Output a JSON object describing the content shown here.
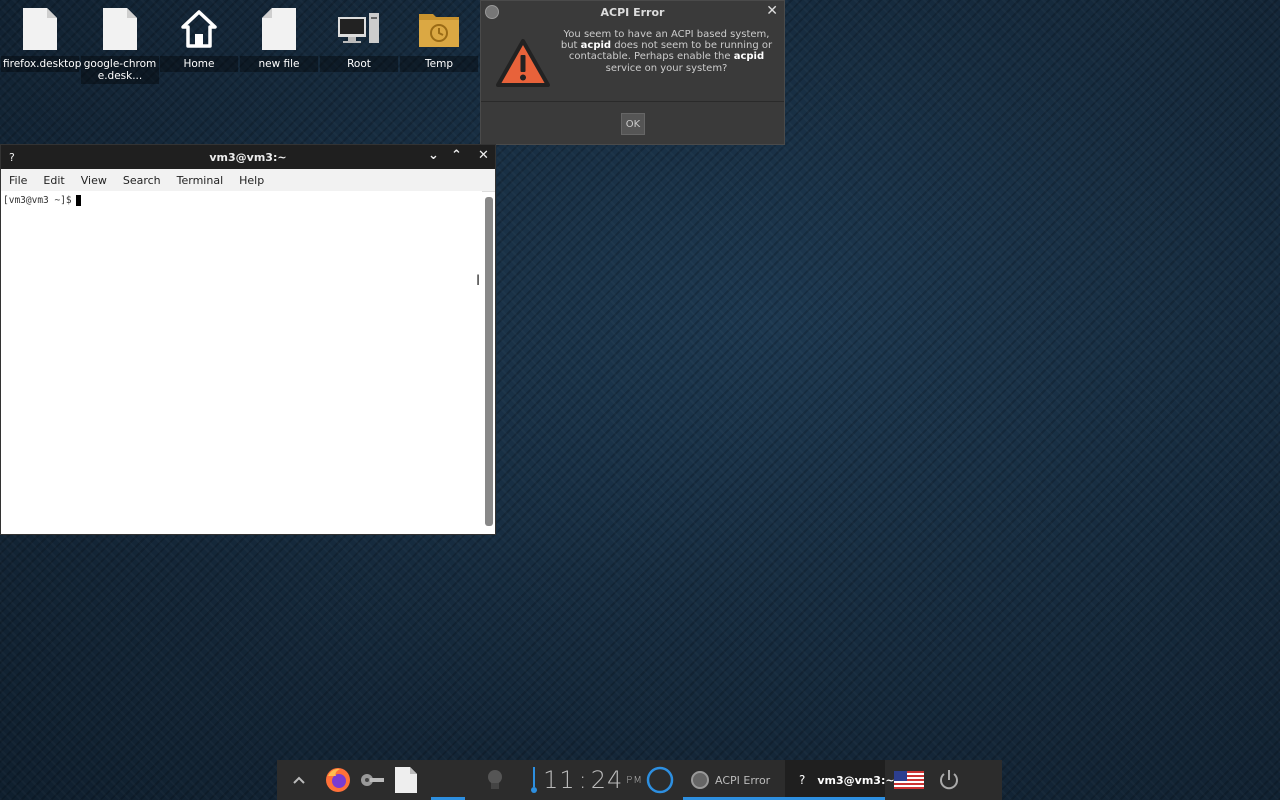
{
  "desktop": {
    "icons": [
      {
        "label": "firefox.desktop"
      },
      {
        "label": "google-chrome.desk..."
      },
      {
        "label": "Home"
      },
      {
        "label": "new file"
      },
      {
        "label": "Root"
      },
      {
        "label": "Temp"
      }
    ]
  },
  "dialog": {
    "title": "ACPI Error",
    "message_parts": {
      "p1": "You seem to have an ACPI based system, but",
      "b1": "acpid",
      "p2": "does not seem to be running or contactable. Perhaps enable the",
      "b2": "acpid",
      "p3": "service on your system?"
    },
    "ok_label": "OK",
    "close_glyph": "✕",
    "icon": "warning-icon"
  },
  "terminal": {
    "title": "vm3@vm3:~",
    "help_glyph": "?",
    "menu": [
      "File",
      "Edit",
      "View",
      "Search",
      "Terminal",
      "Help"
    ],
    "prompt": "[vm3@vm3 ~]$"
  },
  "taskbar": {
    "clock_hours": "11",
    "clock_minutes": "24",
    "clock_ampm": "PM",
    "tasks": [
      {
        "label": "ACPI Error"
      },
      {
        "label": "vm3@vm3:~",
        "glyph": "?"
      }
    ],
    "accent_color": "#2d8fe0"
  }
}
